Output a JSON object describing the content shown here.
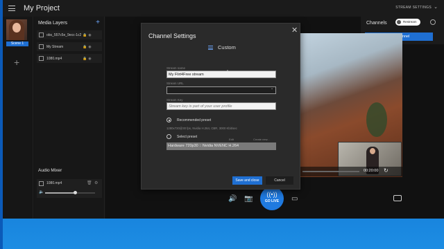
{
  "app": {
    "title": "My Project",
    "stream_settings": "STREAM SETTINGS"
  },
  "scenes": {
    "items": [
      {
        "label": "Scene 1"
      }
    ],
    "add": "+"
  },
  "media_layers": {
    "title": "Media Layers",
    "add": "+",
    "items": [
      {
        "name": "obs_557c5e_9ecc-1c2..."
      },
      {
        "name": "My Stream"
      },
      {
        "name": "1080.mp4"
      }
    ]
  },
  "audio_mixer": {
    "title": "Audio Mixer",
    "items": [
      {
        "name": "1080.mp4",
        "volume": 0.6
      }
    ]
  },
  "channels": {
    "title": "Channels",
    "badge": "Restream",
    "add_button": "Add channel"
  },
  "preview": {
    "time": "00:20:00",
    "progress": 0.0
  },
  "controls": {
    "go_live": "GO LIVE"
  },
  "dialog": {
    "title": "Channel Settings",
    "subtitle": "Custom",
    "stream_name_label": "Stream name",
    "stream_name_value": "My Flirt4Free stream",
    "stream_url_label": "Stream URL",
    "stream_url_value": "",
    "stream_key_label": "Stream Key",
    "stream_key_placeholder": "Stream key is part of your user profile",
    "recommended_label": "Recommended preset",
    "recommended_desc": "1280x720@30 fps, Nvidia H.264, CBR, 3000 Kbit/sec",
    "select_label": "Select preset",
    "col_edit": "Edit",
    "col_create": "Create new...",
    "preset_value": "Hardware 720p30 :: Nvidia NVENC H.264",
    "save_button": "Save and close",
    "cancel_button": "Cancel",
    "recommended_selected": true
  },
  "colors": {
    "accent": "#1f6fd2",
    "app_bg": "#141414",
    "dialog_bg": "#2a2a2a"
  },
  "icons": [
    "menu-icon",
    "plus-icon",
    "lock-icon",
    "eye-icon",
    "gear-icon",
    "speaker-icon",
    "camera-icon",
    "broadcast-icon",
    "chat-icon",
    "close-icon",
    "sliders-icon",
    "loop-icon",
    "chevron-down-icon"
  ]
}
